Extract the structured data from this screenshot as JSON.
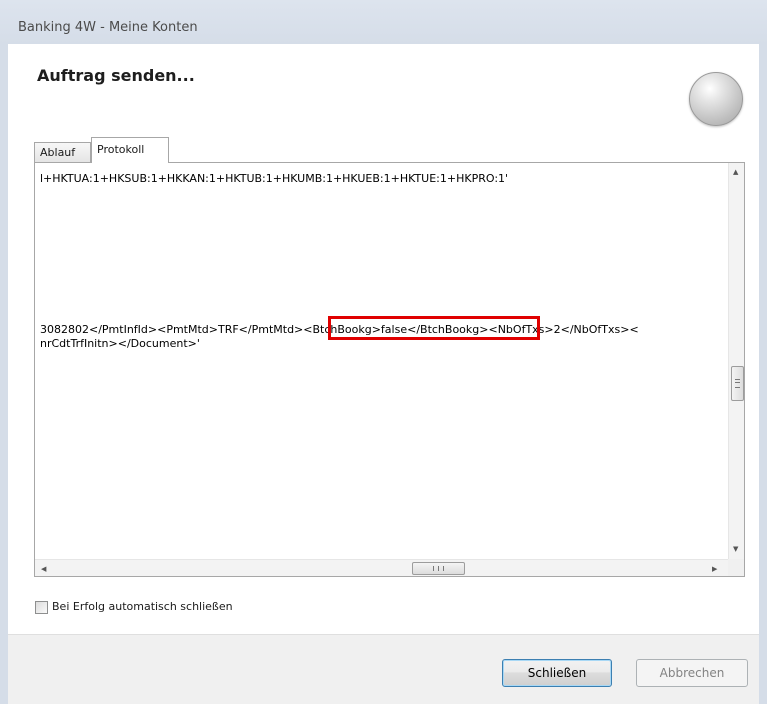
{
  "window": {
    "title": "Banking 4W - Meine Konten"
  },
  "dialog": {
    "heading": "Auftrag senden..."
  },
  "tabs": [
    {
      "label": "Ablauf",
      "active": false
    },
    {
      "label": "Protokoll",
      "active": true
    }
  ],
  "log": {
    "lines": [
      "l+HKTUA:1+HKSUB:1+HKKAN:1+HKTUB:1+HKUMB:1+HKUEB:1+HKTUE:1+HKPRO:1'",
      "3082802</PmtInfId><PmtMtd>TRF</PmtMtd><BtchBookg>false</BtchBookg><NbOfTxs>2</NbOfTxs><",
      "nrCdtTrfInitn></Document>'"
    ],
    "highlight_color": "#e00000"
  },
  "options": {
    "auto_close_label": "Bei Erfolg automatisch schließen",
    "auto_close_checked": false
  },
  "buttons": {
    "close_label": "Schließen",
    "cancel_label": "Abbrechen"
  },
  "icons": {
    "status": "status-orb-icon",
    "scroll_up": "▲",
    "scroll_down": "▼",
    "scroll_left": "◀",
    "scroll_right": "▶"
  }
}
